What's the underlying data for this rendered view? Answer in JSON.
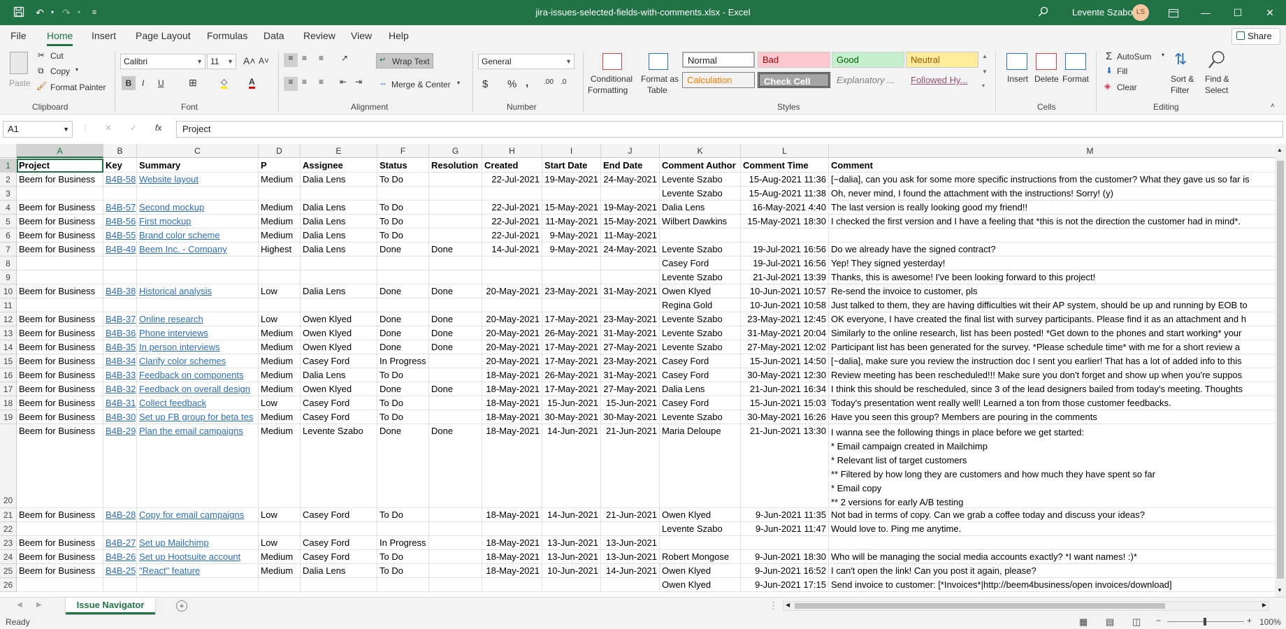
{
  "window": {
    "title": "jira-issues-selected-fields-with-comments.xlsx  -  Excel",
    "user": "Levente Szabo",
    "user_initials": "LS"
  },
  "menu": [
    "File",
    "Home",
    "Insert",
    "Page Layout",
    "Formulas",
    "Data",
    "Review",
    "View",
    "Help"
  ],
  "share_label": "Share",
  "ribbon": {
    "clipboard": {
      "paste": "Paste",
      "cut": "Cut",
      "copy": "Copy",
      "format_painter": "Format Painter",
      "label": "Clipboard"
    },
    "font": {
      "name": "Calibri",
      "size": "11",
      "label": "Font"
    },
    "alignment": {
      "wrap_text": "Wrap Text",
      "merge_center": "Merge & Center",
      "label": "Alignment"
    },
    "number": {
      "format": "General",
      "label": "Number"
    },
    "styles": {
      "conditional": "Conditional",
      "formatting": "Formatting",
      "format_as": "Format as",
      "table": "Table",
      "normal": "Normal",
      "bad": "Bad",
      "good": "Good",
      "neutral": "Neutral",
      "calculation": "Calculation",
      "check_cell": "Check Cell",
      "explanatory": "Explanatory ...",
      "followed": "Followed Hy...",
      "label": "Styles"
    },
    "cells": {
      "insert": "Insert",
      "delete": "Delete",
      "format": "Format",
      "label": "Cells"
    },
    "editing": {
      "autosum": "AutoSum",
      "fill": "Fill",
      "clear": "Clear",
      "sort_filter": "Sort &",
      "filter": "Filter",
      "find_select": "Find &",
      "select": "Select",
      "label": "Editing"
    }
  },
  "formula_bar": {
    "name_box": "A1",
    "value": "Project"
  },
  "colors": {
    "excel_green": "#217346",
    "link_blue": "#2e6fb9"
  },
  "grid": {
    "columns": [
      "A",
      "B",
      "C",
      "D",
      "E",
      "F",
      "G",
      "H",
      "I",
      "J",
      "K",
      "L",
      "M"
    ],
    "rows": [
      {
        "n": "1",
        "cells": [
          "Project",
          "Key",
          "Summary",
          "P",
          "Assignee",
          "Status",
          "Resolution",
          "Created",
          "Start Date",
          "End Date",
          "Comment Author",
          "Comment Time",
          "Comment"
        ]
      },
      {
        "n": "2",
        "cells": [
          "Beem for Business",
          "B4B-58",
          "Website layout",
          "Medium",
          "Dalia Lens",
          "To Do",
          "",
          "22-Jul-2021",
          "19-May-2021",
          "24-May-2021",
          "Levente Szabo",
          "15-Aug-2021 11:36",
          "[~dalia], can you ask for some more specific instructions from the customer? What they gave us so far is"
        ]
      },
      {
        "n": "3",
        "cells": [
          "",
          "",
          "",
          "",
          "",
          "",
          "",
          "",
          "",
          "",
          "Levente Szabo",
          "15-Aug-2021 11:38",
          "Oh, never mind, I found the attachment with the instructions! Sorry! (y)"
        ]
      },
      {
        "n": "4",
        "cells": [
          "Beem for Business",
          "B4B-57",
          "Second mockup",
          "Medium",
          "Dalia Lens",
          "To Do",
          "",
          "22-Jul-2021",
          "15-May-2021",
          "19-May-2021",
          "Dalia Lens",
          "16-May-2021 4:40",
          "The last version is really looking good my friend!!"
        ]
      },
      {
        "n": "5",
        "cells": [
          "Beem for Business",
          "B4B-56",
          "First mockup",
          "Medium",
          "Dalia Lens",
          "To Do",
          "",
          "22-Jul-2021",
          "11-May-2021",
          "15-May-2021",
          "Wilbert Dawkins",
          "15-May-2021 18:30",
          "I checked the first version and I have a feeling that *this is not the direction the customer had in mind*."
        ]
      },
      {
        "n": "6",
        "cells": [
          "Beem for Business",
          "B4B-55",
          "Brand color scheme",
          "Medium",
          "Dalia Lens",
          "To Do",
          "",
          "22-Jul-2021",
          "9-May-2021",
          "11-May-2021",
          "",
          "",
          ""
        ]
      },
      {
        "n": "7",
        "cells": [
          "Beem for Business",
          "B4B-49",
          "Beem Inc. - Company",
          "Highest",
          "Dalia Lens",
          "Done",
          "Done",
          "14-Jul-2021",
          "9-May-2021",
          "24-May-2021",
          "Levente Szabo",
          "19-Jul-2021 16:56",
          "Do we already have the signed contract?"
        ]
      },
      {
        "n": "8",
        "cells": [
          "",
          "",
          "",
          "",
          "",
          "",
          "",
          "",
          "",
          "",
          "Casey Ford",
          "19-Jul-2021 16:56",
          "Yep! They signed yesterday!"
        ]
      },
      {
        "n": "9",
        "cells": [
          "",
          "",
          "",
          "",
          "",
          "",
          "",
          "",
          "",
          "",
          "Levente Szabo",
          "21-Jul-2021 13:39",
          "Thanks, this is awesome! I've been looking forward to this project!"
        ]
      },
      {
        "n": "10",
        "cells": [
          "Beem for Business",
          "B4B-38",
          "Historical analysis",
          "Low",
          "Dalia Lens",
          "Done",
          "Done",
          "20-May-2021",
          "23-May-2021",
          "31-May-2021",
          "Owen Klyed",
          "10-Jun-2021 10:57",
          "Re-send the invoice to customer, pls"
        ]
      },
      {
        "n": "11",
        "cells": [
          "",
          "",
          "",
          "",
          "",
          "",
          "",
          "",
          "",
          "",
          "Regina Gold",
          "10-Jun-2021 10:58",
          "Just talked to them, they are having difficulties wit their AP system, should be up and running by EOB to"
        ]
      },
      {
        "n": "12",
        "cells": [
          "Beem for Business",
          "B4B-37",
          "Online research",
          "Low",
          "Owen Klyed",
          "Done",
          "Done",
          "20-May-2021",
          "17-May-2021",
          "23-May-2021",
          "Levente Szabo",
          "23-May-2021 12:45",
          "OK everyone, I have created the final list with survey participants. Please find it as an attachment and h"
        ]
      },
      {
        "n": "13",
        "cells": [
          "Beem for Business",
          "B4B-36",
          "Phone interviews",
          "Medium",
          "Owen Klyed",
          "Done",
          "Done",
          "20-May-2021",
          "26-May-2021",
          "31-May-2021",
          "Levente Szabo",
          "31-May-2021 20:04",
          "Similarly to the online research, list has been posted! *Get down to the phones and start working* your"
        ]
      },
      {
        "n": "14",
        "cells": [
          "Beem for Business",
          "B4B-35",
          "In person interviews",
          "Medium",
          "Owen Klyed",
          "Done",
          "Done",
          "20-May-2021",
          "17-May-2021",
          "27-May-2021",
          "Levente Szabo",
          "27-May-2021 12:02",
          "Participant list has been generated for the survey. *Please schedule time* with me for a short review a"
        ]
      },
      {
        "n": "15",
        "cells": [
          "Beem for Business",
          "B4B-34",
          "Clarify color schemes",
          "Medium",
          "Casey Ford",
          "In Progress",
          "",
          "20-May-2021",
          "17-May-2021",
          "23-May-2021",
          "Casey Ford",
          "15-Jun-2021 14:50",
          "[~dalia], make sure you review the instruction doc I sent you earlier! That has a lot of added info to this"
        ]
      },
      {
        "n": "16",
        "cells": [
          "Beem for Business",
          "B4B-33",
          "Feedback on components",
          "Medium",
          "Dalia Lens",
          "To Do",
          "",
          "18-May-2021",
          "26-May-2021",
          "31-May-2021",
          "Casey Ford",
          "30-May-2021 12:30",
          "Review meeting has been rescheduled!!! Make sure you don't forget and show up when you're suppos"
        ]
      },
      {
        "n": "17",
        "cells": [
          "Beem for Business",
          "B4B-32",
          "Feedback on overall design",
          "Medium",
          "Owen Klyed",
          "Done",
          "Done",
          "18-May-2021",
          "17-May-2021",
          "27-May-2021",
          "Dalia Lens",
          "21-Jun-2021 16:34",
          "I think this should be rescheduled, since 3 of the lead designers bailed from today's meeting. Thoughts"
        ]
      },
      {
        "n": "18",
        "cells": [
          "Beem for Business",
          "B4B-31",
          "Collect feedback",
          "Low",
          "Casey Ford",
          "To Do",
          "",
          "18-May-2021",
          "15-Jun-2021",
          "15-Jun-2021",
          "Casey Ford",
          "15-Jun-2021 15:03",
          "Today's presentation went really well! Learned a ton from those customer feedbacks."
        ]
      },
      {
        "n": "19",
        "cells": [
          "Beem for Business",
          "B4B-30",
          "Set up FB group for beta tes",
          "Medium",
          "Casey Ford",
          "To Do",
          "",
          "18-May-2021",
          "30-May-2021",
          "30-May-2021",
          "Levente Szabo",
          "30-May-2021 16:26",
          "Have you seen this group? Members are pouring in the comments"
        ]
      },
      {
        "n": "20",
        "cells": [
          "Beem for Business",
          "B4B-29",
          "Plan the email campaigns",
          "Medium",
          "Levente Szabo",
          "Done",
          "Done",
          "18-May-2021",
          "14-Jun-2021",
          "21-Jun-2021",
          "Maria Deloupe",
          "21-Jun-2021 13:30",
          "I wanna see the following things in place before we get started:\n* Email campaign created in Mailchimp\n* Relevant list of target customers\n** Filtered by how long they are customers and how much they have spent so far\n* Email copy\n** 2 versions for early A/B testing"
        ]
      },
      {
        "n": "21",
        "cells": [
          "Beem for Business",
          "B4B-28",
          "Copy for email campaigns",
          "Low",
          "Casey Ford",
          "To Do",
          "",
          "18-May-2021",
          "14-Jun-2021",
          "21-Jun-2021",
          "Owen Klyed",
          "9-Jun-2021 11:35",
          "Not bad in terms of copy. Can we grab a coffee today and discuss your ideas?"
        ]
      },
      {
        "n": "22",
        "cells": [
          "",
          "",
          "",
          "",
          "",
          "",
          "",
          "",
          "",
          "",
          "Levente Szabo",
          "9-Jun-2021 11:47",
          "Would love to. Ping me anytime."
        ]
      },
      {
        "n": "23",
        "cells": [
          "Beem for Business",
          "B4B-27",
          "Set up Mailchimp",
          "Low",
          "Casey Ford",
          "In Progress",
          "",
          "18-May-2021",
          "13-Jun-2021",
          "13-Jun-2021",
          "",
          "",
          ""
        ]
      },
      {
        "n": "24",
        "cells": [
          "Beem for Business",
          "B4B-26",
          "Set up Hootsuite account",
          "Medium",
          "Casey Ford",
          "To Do",
          "",
          "18-May-2021",
          "13-Jun-2021",
          "13-Jun-2021",
          "Robert Mongose",
          "9-Jun-2021 18:30",
          "Who will be managing the social media accounts exactly? *I want names! :)*"
        ]
      },
      {
        "n": "25",
        "cells": [
          "Beem for Business",
          "B4B-25",
          "\"React\" feature",
          "Medium",
          "Dalia Lens",
          "To Do",
          "",
          "18-May-2021",
          "10-Jun-2021",
          "14-Jun-2021",
          "Owen Klyed",
          "9-Jun-2021 16:52",
          "I can't open the link! Can you post it again, please?"
        ]
      },
      {
        "n": "26",
        "cells": [
          "",
          "",
          "",
          "",
          "",
          "",
          "",
          "",
          "",
          "",
          "Owen Klyed",
          "9-Jun-2021 17:15",
          "Send invoice to customer: [*Invoices*|http://beem4business/open invoices/download]"
        ]
      }
    ]
  },
  "sheet_tab": "Issue Navigator",
  "status": {
    "ready": "Ready",
    "zoom": "100%"
  }
}
